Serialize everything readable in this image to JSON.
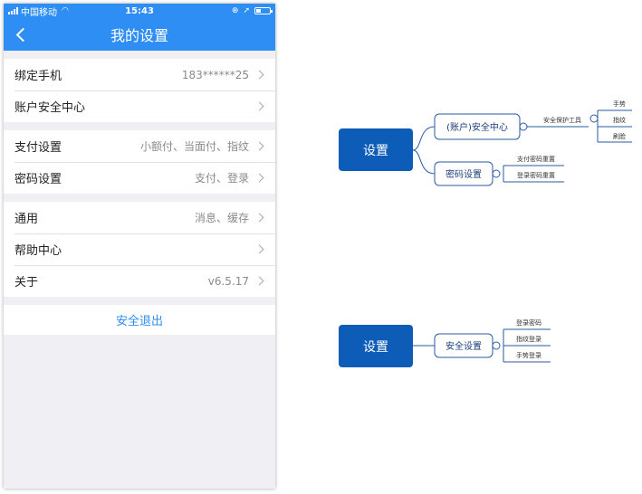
{
  "statusbar": {
    "carrier": "中国移动",
    "time": "15:43",
    "battery_level": 0.35
  },
  "navbar": {
    "title": "我的设置"
  },
  "groups": [
    [
      {
        "label": "绑定手机",
        "value": "183******25"
      },
      {
        "label": "账户安全中心",
        "value": ""
      }
    ],
    [
      {
        "label": "支付设置",
        "value": "小额付、当面付、指纹"
      },
      {
        "label": "密码设置",
        "value": "支付、登录"
      }
    ],
    [
      {
        "label": "通用",
        "value": "消息、缓存"
      },
      {
        "label": "帮助中心",
        "value": ""
      },
      {
        "label": "关于",
        "value": "v6.5.17"
      }
    ]
  ],
  "logout_label": "安全退出",
  "mindmap1": {
    "root": "设置",
    "branch1": {
      "label": "(账户)安全中心",
      "sub": "安全保护工具",
      "leaves": [
        "手势",
        "指纹",
        "刷脸"
      ]
    },
    "branch2": {
      "label": "密码设置",
      "leaves": [
        "支付密码重置",
        "登录密码重置"
      ]
    }
  },
  "mindmap2": {
    "root": "设置",
    "branch": {
      "label": "安全设置",
      "leaves": [
        "登录密码",
        "指纹登录",
        "手势登录"
      ]
    }
  },
  "colors": {
    "brand_blue": "#2f8ef3",
    "mindmap_root": "#0d5db8",
    "mindmap_line": "#2a5aa6"
  }
}
